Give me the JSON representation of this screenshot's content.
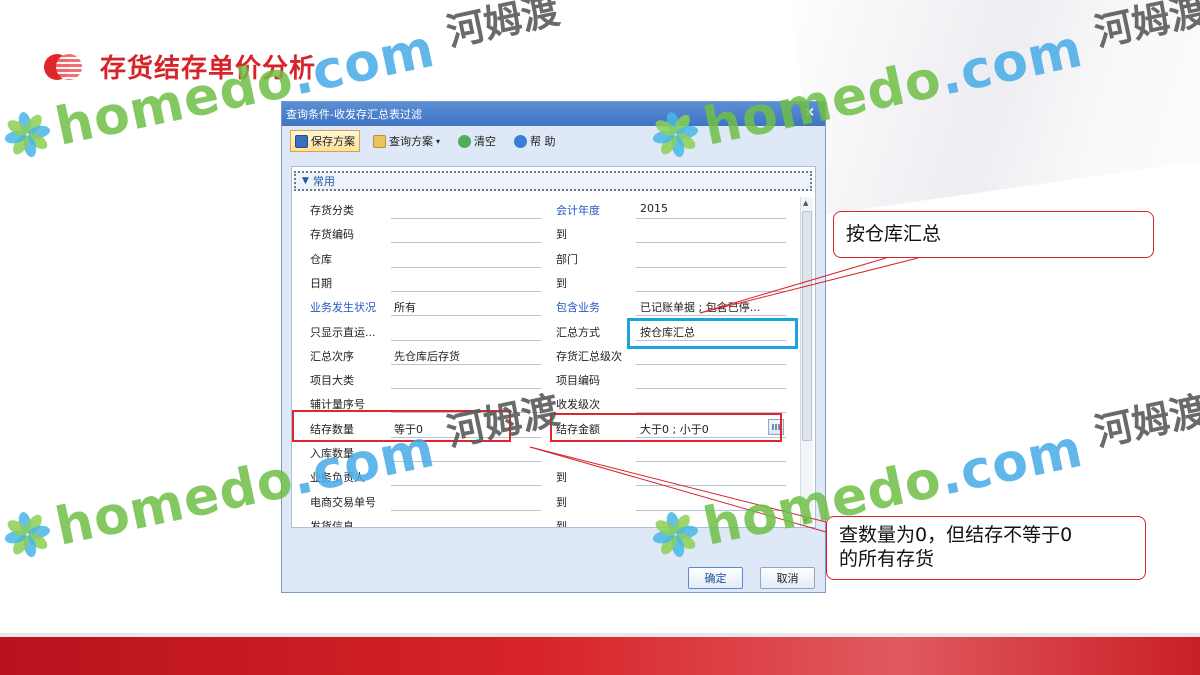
{
  "slide": {
    "title": "存货结存单价分析"
  },
  "watermark": {
    "brand_latin": "homedo",
    "brand_com": ".com",
    "brand_cn": "河姆渡"
  },
  "dialog": {
    "title": "查询条件-收发存汇总表过滤",
    "close_glyph": "×",
    "toolbar": {
      "save_scheme": "保存方案",
      "query_scheme": "查询方案",
      "query_scheme_caret": "▾",
      "clear": "清空",
      "help": "帮 助"
    },
    "group_label": "常用",
    "group_arrow": "▼",
    "rows": [
      {
        "left_label": "存货分类",
        "left_value": "",
        "right_label": "会计年度",
        "right_value": "2015"
      },
      {
        "left_label": "存货编码",
        "left_value": "",
        "right_label": "到",
        "right_value": ""
      },
      {
        "left_label": "仓库",
        "left_value": "",
        "right_label": "部门",
        "right_value": ""
      },
      {
        "left_label": "日期",
        "left_value": "",
        "right_label": "到",
        "right_value": ""
      },
      {
        "left_label": "业务发生状况",
        "left_value": "所有",
        "right_label": "包含业务",
        "right_value": "已记账单据 ; 包含已停..."
      },
      {
        "left_label": "只显示直运...",
        "left_value": "",
        "right_label": "汇总方式",
        "right_value": "按仓库汇总"
      },
      {
        "left_label": "汇总次序",
        "left_value": "先仓库后存货",
        "right_label": "存货汇总级次",
        "right_value": ""
      },
      {
        "left_label": "项目大类",
        "left_value": "",
        "right_label": "项目编码",
        "right_value": ""
      },
      {
        "left_label": "辅计量序号",
        "left_value": "",
        "right_label": "收发级次",
        "right_value": ""
      },
      {
        "left_label": "结存数量",
        "left_value": "等于0",
        "right_label": "结存金额",
        "right_value": "大于0 ; 小于0"
      },
      {
        "left_label": "入库数量",
        "left_value": "",
        "right_label": "",
        "right_value": ""
      },
      {
        "left_label": "业务负责人",
        "left_value": "",
        "right_label": "到",
        "right_value": ""
      },
      {
        "left_label": "电商交易单号",
        "left_value": "",
        "right_label": "到",
        "right_value": ""
      },
      {
        "left_label": "发货信息",
        "left_value": "",
        "right_label": "到",
        "right_value": ""
      }
    ],
    "ok": "确定",
    "cancel": "取消"
  },
  "callouts": {
    "warehouse": "按仓库汇总",
    "balance_line1": "查数量为0，但结存不等于0",
    "balance_line2": "的所有存货"
  },
  "colors": {
    "accent_red": "#d7242a",
    "highlight_blue": "#1aa3dd",
    "dialog_header": "#4a80cc"
  }
}
